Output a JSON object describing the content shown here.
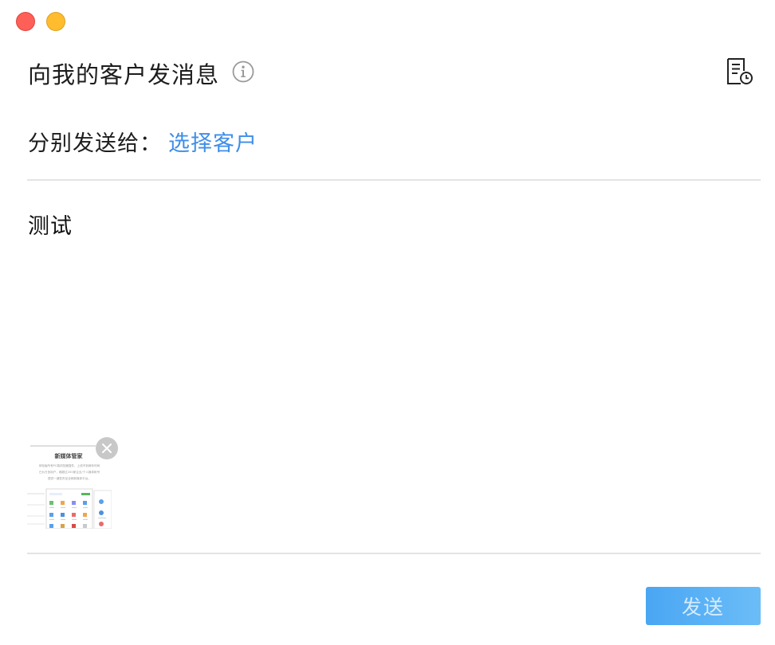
{
  "window": {
    "close_color": "#fe5f57",
    "minimize_color": "#febc2e"
  },
  "header": {
    "title": "向我的客户发消息",
    "info_icon": "info-icon",
    "history_icon": "document-clock-icon"
  },
  "recipients": {
    "label": "分别发送给：",
    "select_link": "选择客户",
    "link_color": "#3d8ee9"
  },
  "message": {
    "text": "测试"
  },
  "attachment": {
    "thumbnail_title": "新媒体管家",
    "thumbnail_line1": "体验版所有PC端浏览器插件，上线不到两年时间",
    "thumbnail_line2": "已为万多用户，都超过200家企业/个人媒体帐号",
    "thumbnail_line3": "提供一键发布至全网新媒体平台。",
    "remove_icon": "close-icon"
  },
  "footer": {
    "send_label": "发送",
    "accent_color": "#4aa6f3"
  }
}
